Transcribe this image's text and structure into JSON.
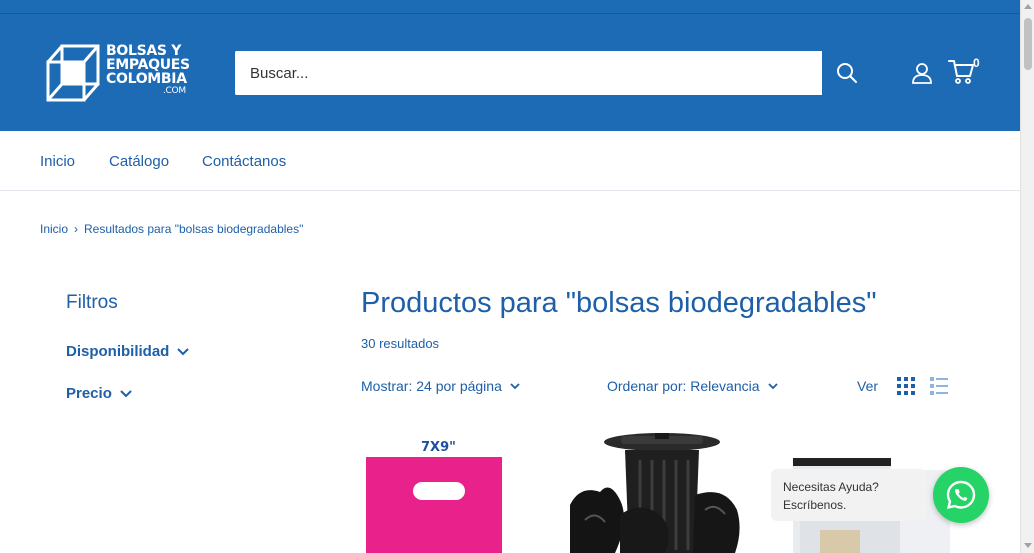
{
  "brand": {
    "line1": "BOLSAS Y",
    "line2": "EMPAQUES",
    "line3": "COLOMBIA",
    "domain": ".COM",
    "header_color": "#1d6bb5"
  },
  "search": {
    "placeholder": "Buscar..."
  },
  "cart": {
    "count": "0"
  },
  "nav": {
    "items": [
      {
        "label": "Inicio"
      },
      {
        "label": "Catálogo"
      },
      {
        "label": "Contáctanos"
      }
    ]
  },
  "breadcrumb": {
    "home": "Inicio",
    "separator": "›",
    "current": "Resultados para \"bolsas biodegradables\""
  },
  "filters": {
    "title": "Filtros",
    "items": [
      {
        "label": "Disponibilidad"
      },
      {
        "label": "Precio"
      }
    ]
  },
  "main": {
    "title": "Productos para \"bolsas biodegradables\"",
    "results": "30 resultados"
  },
  "toolbar": {
    "show_label": "Mostrar: 24 por página",
    "sort_label": "Ordenar por: Relevancia",
    "view_label": "Ver"
  },
  "products": [
    {
      "image_label": "7X9\"",
      "image": "pink-bag"
    },
    {
      "image": "trash-can-bags"
    },
    {
      "image": "clear-bags"
    }
  ],
  "chat": {
    "line1": "Necesitas Ayuda?",
    "line2": "Escríbenos.",
    "color": "#25d366"
  }
}
